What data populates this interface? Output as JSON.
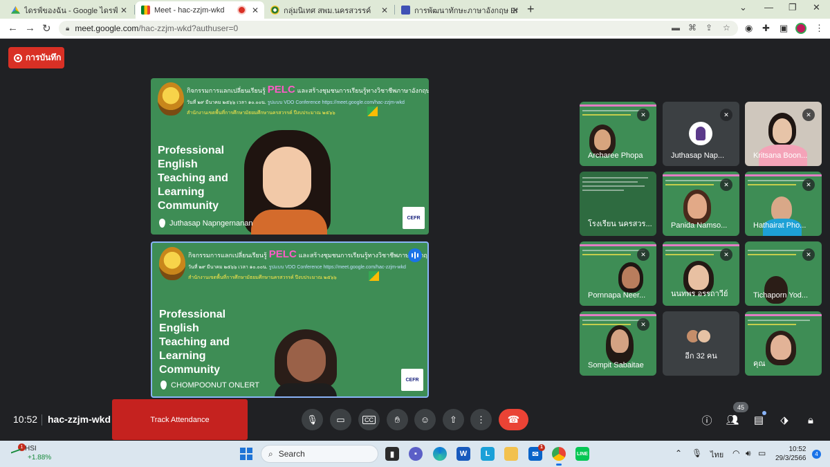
{
  "browser": {
    "tabs": [
      {
        "title": "ไดรฟ์ของฉัน - Google ไดรฟ์",
        "active": false,
        "recording": false
      },
      {
        "title": "Meet - hac-zzjm-wkd",
        "active": true,
        "recording": true
      },
      {
        "title": "กลุ่มนิเทศ สพม.นครสวรรค์",
        "active": false,
        "recording": false
      },
      {
        "title": "การพัฒนาทักษะภาษาอังกฤษ English",
        "active": false,
        "recording": false
      }
    ],
    "url_domain": "meet.google.com",
    "url_path": "/hac-zzjm-wkd?authuser=0"
  },
  "meet": {
    "recording_label": "การบันทึก",
    "banner": {
      "line1_pre": "กิจกรรมการแลกเปลี่ยนเรียนรู้",
      "line1_brand": "PELC",
      "line1_post": "และสร้างชุมชนการเรียนรู้ทางวิชาชีพภาษาอังกฤษ",
      "line2_date": "วันที่ ๒๙ มีนาคม ๒๕๖๖ เวลา ๑๐.๐๐น.",
      "line2_link": "รูปแบบ VDO Conference https://meet.google.com/hac-zzjm-wkd",
      "line3": "สำนักงานเขตพื้นที่การศึกษามัธยมศึกษานครสวรรค์ ปีงบประมาณ ๒๕๖๖",
      "slide_title": "Professional English Teaching and Learning Community",
      "cefr_label": "CEFR"
    },
    "stage": [
      {
        "name": "Juthasap Napngernanan",
        "speaking": false
      },
      {
        "name": "CHOMPOONUT ONLERT",
        "speaking": true
      }
    ],
    "grid": [
      {
        "name": "Archaree Phopa",
        "style": "green",
        "muted": true
      },
      {
        "name": "Juthasap Nap...",
        "style": "avatar",
        "muted": true
      },
      {
        "name": "Kritsana Boon...",
        "style": "photo",
        "muted": true
      },
      {
        "name": "โรงเรียน นครสวร...",
        "style": "green",
        "muted": false
      },
      {
        "name": "Panida Namso...",
        "style": "green",
        "muted": true
      },
      {
        "name": "Hathairat Pho...",
        "style": "green",
        "muted": true
      },
      {
        "name": "Pornnapa Neer...",
        "style": "green",
        "muted": true
      },
      {
        "name": "นนทพร อรรถาวีย์",
        "style": "green",
        "muted": true
      },
      {
        "name": "Tichaporn Yod...",
        "style": "green",
        "muted": true
      },
      {
        "name": "Sompit Sabaitae",
        "style": "green",
        "muted": true
      },
      {
        "name": "อีก 32 คน",
        "style": "more",
        "muted": false
      },
      {
        "name": "คุณ",
        "style": "green",
        "muted": false
      }
    ],
    "bottom": {
      "time": "10:52",
      "meeting_code": "hac-zzjm-wkd",
      "track_attendance": "Track Attendance",
      "participant_count": "45"
    }
  },
  "taskbar": {
    "stock_name": "HSI",
    "stock_change": "+1.88%",
    "stock_badge": "1",
    "search_label": "Search",
    "mail_badge": "1",
    "lang": "ไทย",
    "clock_time": "10:52",
    "clock_date": "29/3/2566",
    "notifications": "4"
  },
  "colors": {
    "meet_bg": "#202124",
    "slide_green": "#3e8d55",
    "record_red": "#d93025",
    "hangup_red": "#ea4335",
    "speaking_blue": "#8ab4f8"
  }
}
